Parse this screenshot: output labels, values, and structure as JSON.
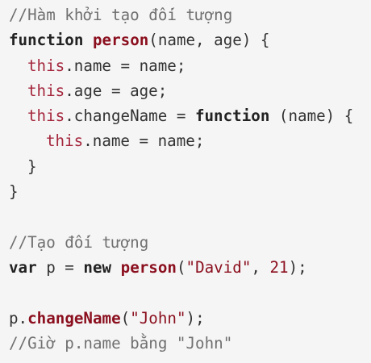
{
  "code": {
    "l1": {
      "comment": "//Hàm khởi tạo đối tượng"
    },
    "l2": {
      "kw": "function",
      "fn": "person",
      "rest": "(name, age) {"
    },
    "l3": {
      "this": "this",
      "rest": ".name = name;"
    },
    "l4": {
      "this": "this",
      "rest": ".age = age;"
    },
    "l5": {
      "this": "this",
      "mid": ".changeName = ",
      "kw": "function",
      "rest": " (name) {"
    },
    "l6": {
      "this": "this",
      "rest": ".name = name;"
    },
    "l7": {
      "text": "}"
    },
    "l8": {
      "text": "}"
    },
    "l10": {
      "comment": "//Tạo đối tượng"
    },
    "l11": {
      "kw1": "var",
      "mid1": " p = ",
      "kw2": "new",
      "sp": " ",
      "fn": "person",
      "open": "(",
      "str": "\"David\"",
      "comma": ", ",
      "num": "21",
      "close": ");"
    },
    "l13": {
      "obj": "p.",
      "fn": "changeName",
      "open": "(",
      "str": "\"John\"",
      "close": ");"
    },
    "l14": {
      "comment": "//Giờ p.name bằng \"John\""
    }
  }
}
